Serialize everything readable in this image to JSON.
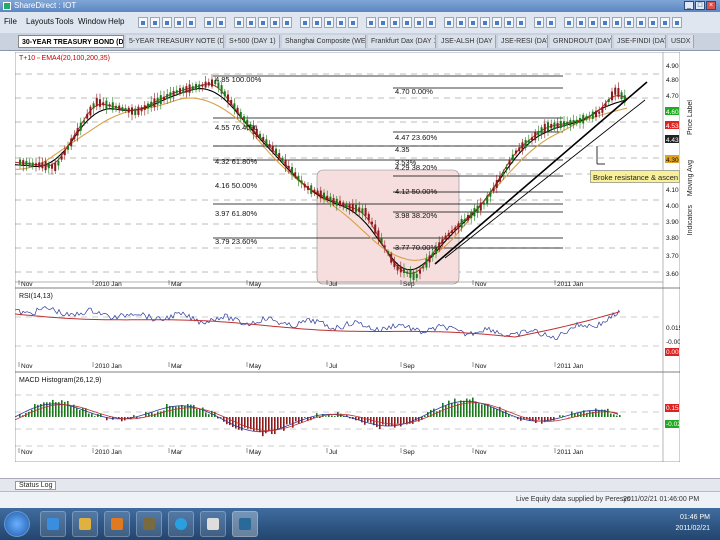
{
  "window": {
    "title": "ShareDirect : IOT"
  },
  "menu": [
    "File",
    "Layouts",
    "Tools",
    "Window",
    "Help"
  ],
  "tabs": [
    "30-YEAR TREASURY BOND (DAY 1)",
    "5-YEAR TREASURY NOTE (DAY 1)",
    "S+500 (DAY 1)",
    "Shanghai Composite (WEEK 1)",
    "Frankfurt Dax (DAY 1)",
    "JSE-ALSH (DAY 1)",
    "JSE-RESI (DAY 1)",
    "GRNDROUT (DAY 1)",
    "JSE-FINDI (DAY 1)",
    "USDX"
  ],
  "price_panel": {
    "label": "T+10 ▫ EMA4(20,100,200,35)",
    "fib_levels": [
      "4.85 100.00%",
      "4.70 0.00%",
      "4.55 76.40%",
      "4.47 23.60%",
      "4.35",
      "4.32 61.80%",
      "3.53%",
      "4.29 38.20%",
      "4.16 50.00%",
      "4.12 50.00%",
      "3.97 61.80%",
      "3.98 38.20%",
      "3.77 70.00%",
      "3.79 23.60%"
    ],
    "annotation": "Broke resistance & ascen",
    "y_ticks": [
      "4.90",
      "4.80",
      "4.70",
      "4.60",
      "4.53",
      "4.43",
      "4.30",
      "4.20",
      "4.10",
      "4.00",
      "3.90",
      "3.80",
      "3.70",
      "3.60"
    ],
    "x_ticks": [
      "Nov",
      "2010 Jan",
      "Mar",
      "May",
      "Jul",
      "Sep",
      "Nov",
      "2011 Jan"
    ]
  },
  "rsi_panel": {
    "label": "RSI(14,13)",
    "y_ticks": [
      "0.015",
      "0.005",
      "-0.005"
    ],
    "x_ticks": [
      "Nov",
      "2010 Jan",
      "Mar",
      "May",
      "Jul",
      "Sep",
      "Nov",
      "2011 Jan"
    ]
  },
  "macd_panel": {
    "label": "MACD Histogram(26,12,9)",
    "y_ticks": [
      "0.30",
      "0.15",
      "-0.025"
    ],
    "x_ticks": [
      "Nov",
      "2010 Jan",
      "Mar",
      "May",
      "Jul",
      "Sep",
      "Nov",
      "2011 Jan"
    ]
  },
  "side_tags": [
    "Price Label",
    "Moving Avg",
    "Indicators"
  ],
  "status": {
    "tab": "Status Log"
  },
  "infobar": {
    "source": "Live Equity data supplied by Peresys",
    "datetime": "2011/02/21 01:46:00 PM"
  },
  "clock": {
    "time": "01:46 PM",
    "date": "2011/02/21"
  },
  "colors": {
    "up": "#1a7a1a",
    "down": "#8b1a1a",
    "ema_black": "#000000",
    "ema_orange": "#d8a048",
    "ema_red": "#c03030",
    "rsi_blue": "#2a3a9a",
    "box_fill": "#f6dede"
  }
}
